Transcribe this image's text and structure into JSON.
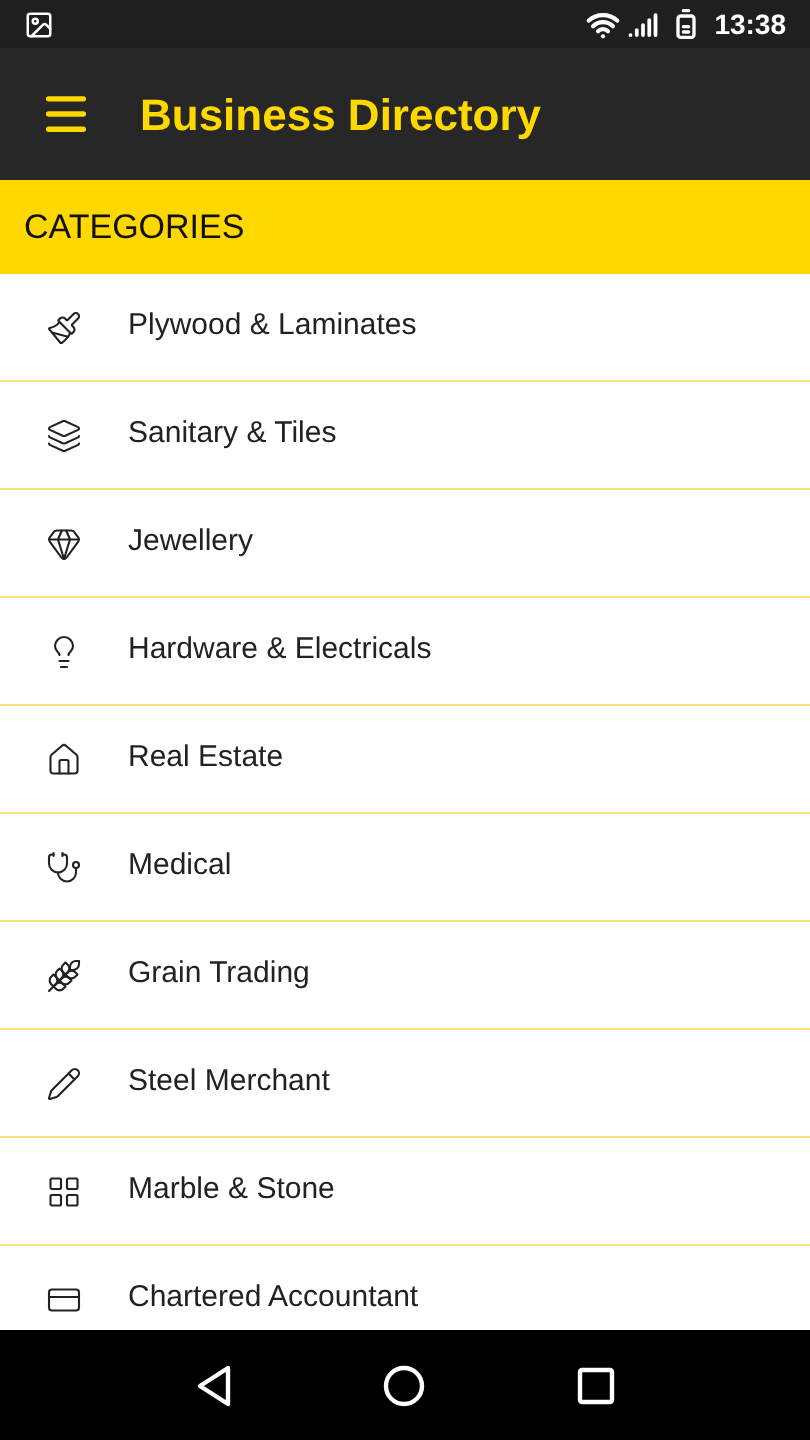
{
  "status_bar": {
    "time": "13:38"
  },
  "app_bar": {
    "title": "Business Directory"
  },
  "section": {
    "title": "CATEGORIES"
  },
  "categories": [
    {
      "label": "Plywood & Laminates"
    },
    {
      "label": "Sanitary & Tiles"
    },
    {
      "label": "Jewellery"
    },
    {
      "label": "Hardware & Electricals"
    },
    {
      "label": "Real Estate"
    },
    {
      "label": "Medical"
    },
    {
      "label": "Grain Trading"
    },
    {
      "label": "Steel Merchant"
    },
    {
      "label": "Marble & Stone"
    },
    {
      "label": "Chartered Accountant"
    }
  ]
}
